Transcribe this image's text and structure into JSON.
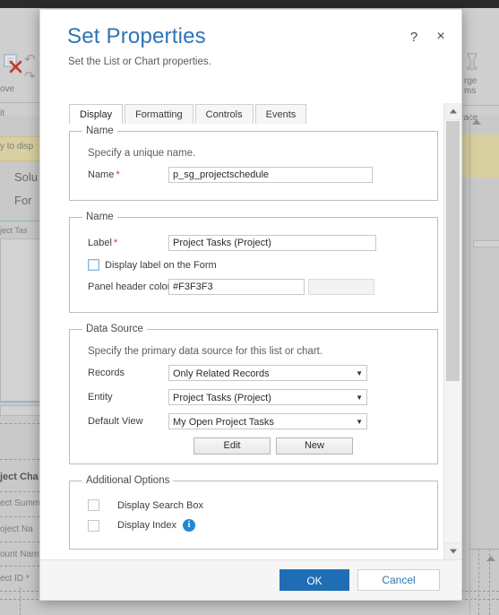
{
  "dialog": {
    "title": "Set Properties",
    "subtitle": "Set the List or Chart properties.",
    "help_icon": "?",
    "close_icon": "×",
    "tabs": [
      {
        "label": "Display",
        "active": true
      },
      {
        "label": "Formatting",
        "active": false
      },
      {
        "label": "Controls",
        "active": false
      },
      {
        "label": "Events",
        "active": false
      }
    ],
    "name_group": {
      "legend": "Name",
      "hint": "Specify a unique name.",
      "name_label": "Name",
      "name_required": "*",
      "name_value": "p_sg_projectschedule",
      "name_placeholder": ""
    },
    "label_group": {
      "legend": "Name",
      "label_label": "Label",
      "label_required": "*",
      "label_value": "Project Tasks (Project)",
      "label_placeholder": "",
      "display_label_checkbox": "Display label on the Form",
      "display_label_checked": false,
      "panel_header_color_label": "Panel header color",
      "panel_header_color_value": "#F3F3F3",
      "panel_header_color_swatch": "#F3F3F3"
    },
    "data_source_group": {
      "legend": "Data Source",
      "hint": "Specify the primary data source for this list or chart.",
      "records_label": "Records",
      "records_value": "Only Related Records",
      "entity_label": "Entity",
      "entity_value": "Project Tasks (Project)",
      "default_view_label": "Default View",
      "default_view_value": "My Open Project Tasks",
      "edit_button": "Edit",
      "new_button": "New",
      "caret_icon": "▼"
    },
    "additional_options_group": {
      "legend": "Additional Options",
      "search_box_checkbox": "Display Search Box",
      "search_box_checked": false,
      "index_checkbox": "Display Index",
      "index_checked": false,
      "info_icon": "i"
    },
    "footer": {
      "ok": "OK",
      "cancel": "Cancel"
    },
    "scrollbar": {
      "up_icon": "▲",
      "down_icon": "▼"
    },
    "colors": {
      "title": "#2E74B5",
      "primary_button": "#1F6EB5",
      "link": "#2E74B5",
      "info": "#1F8AD2",
      "required": "#C0392B"
    }
  },
  "background": {
    "ribbon": {
      "remove_label": "ove",
      "edit_label": "it",
      "merge_label_1": "rge",
      "merge_label_2": "ms",
      "trace_label": "race",
      "undo_icon": "↶",
      "redo_icon": "↷"
    },
    "banner_text": "y to disp",
    "nav": {
      "solution": "Solu",
      "forms": "For"
    },
    "panel_caption": "ject Tas",
    "form_fields": [
      "ject Cha",
      "ect Summ",
      "oject Na",
      "ount Nam",
      "ect ID *"
    ]
  }
}
